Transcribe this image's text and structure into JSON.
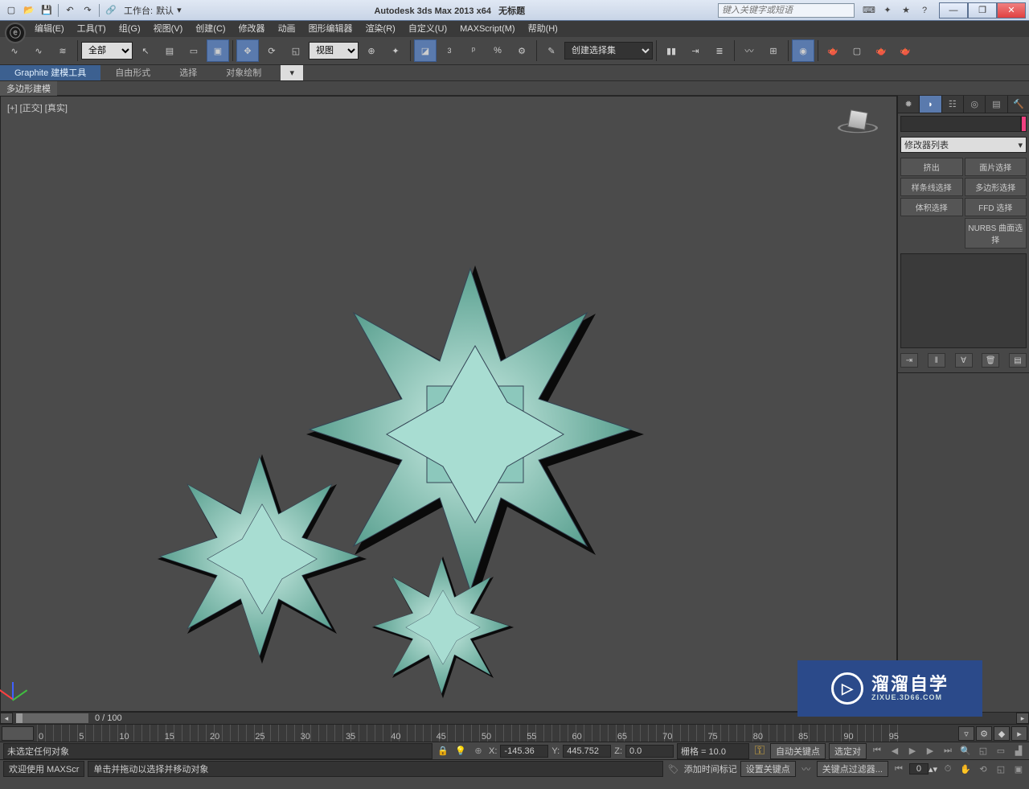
{
  "titlebar": {
    "workspace_label": "工作台:",
    "workspace_value": "默认",
    "app_title": "Autodesk 3ds Max  2013 x64",
    "doc_title": "无标题",
    "search_placeholder": "键入关键字或短语"
  },
  "menu": {
    "items": [
      "编辑(E)",
      "工具(T)",
      "组(G)",
      "视图(V)",
      "创建(C)",
      "修改器",
      "动画",
      "图形编辑器",
      "渲染(R)",
      "自定义(U)",
      "MAXScript(M)",
      "帮助(H)"
    ]
  },
  "toolbar": {
    "filter_label": "全部",
    "view_label": "视图",
    "selset_label": "创建选择集"
  },
  "ribbon": {
    "tabs": [
      "Graphite 建模工具",
      "自由形式",
      "选择",
      "对象绘制"
    ],
    "sublabel": "多边形建模"
  },
  "viewport": {
    "label": "[+] [正交] [真实]"
  },
  "rpanel": {
    "modlist": "修改器列表",
    "buttons": [
      "挤出",
      "面片选择",
      "样条线选择",
      "多边形选择",
      "体积选择",
      "FFD 选择"
    ],
    "nurbs": "NURBS 曲面选择"
  },
  "trackbar": {
    "frame": "0 / 100"
  },
  "timeline": {
    "ticks": [
      "0",
      "5",
      "10",
      "15",
      "20",
      "25",
      "30",
      "35",
      "40",
      "45",
      "50",
      "55",
      "60",
      "65",
      "70",
      "75",
      "80",
      "85",
      "90",
      "95"
    ]
  },
  "status": {
    "none_selected": "未选定任何对象",
    "x_label": "X:",
    "x_val": "-145.36",
    "y_label": "Y:",
    "y_val": "445.752",
    "z_label": "Z:",
    "z_val": "0.0",
    "grid": "栅格 = 10.0",
    "autokey": "自动关键点",
    "selset": "选定对",
    "welcome": "欢迎使用  MAXScr",
    "hint": "单击并拖动以选择并移动对象",
    "addtime": "添加时间标记",
    "setkey": "设置关键点",
    "keyfilter": "关键点过滤器...",
    "spin_val": "0"
  },
  "watermark": {
    "line1": "溜溜自学",
    "line2": "ZIXUE.3D66.COM"
  }
}
